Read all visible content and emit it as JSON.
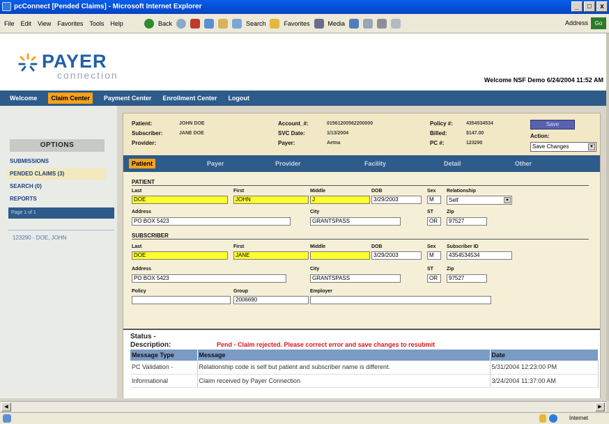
{
  "window": {
    "title": "pcConnect [Pended Claims] - Microsoft Internet Explorer",
    "buttons": [
      "_",
      "□",
      "x"
    ]
  },
  "toolbar": {
    "menus": [
      "File",
      "Edit",
      "View",
      "Favorites",
      "Tools",
      "Help"
    ],
    "back": "Back",
    "search": "Search",
    "favorites": "Favorites",
    "media": "Media",
    "address_label": "Address",
    "go": "Go"
  },
  "logo": {
    "word1": "PAYER",
    "word2": "connection"
  },
  "welcome_text": "Welcome NSF Demo 6/24/2004 11:52 AM",
  "topnav": [
    "Welcome",
    "Claim Center",
    "Payment Center",
    "Enrollment Center",
    "Logout"
  ],
  "left": {
    "options_header": "OPTIONS",
    "items": [
      "SUBMISSIONS",
      "PENDED CLAIMS (3)",
      "SEARCH (0)",
      "REPORTS"
    ],
    "page": "Page 1 of 1",
    "claim": "123290 - DOE, JOHN"
  },
  "header": {
    "patient_label": "Patient:",
    "patient": "JOHN DOE",
    "subscriber_label": "Subscriber:",
    "subscriber": "JANE DOE",
    "provider_label": "Provider:",
    "provider": "",
    "account_label": "Account_#:",
    "account": "01561200562200000",
    "svc_label": "SVC Date:",
    "svc": "1/13/2004",
    "payer_label": "Payer:",
    "payer": "Aetna",
    "policy_label": "Policy #:",
    "policy": "4354534534",
    "billed_label": "Billed:",
    "billed": "$147.00",
    "pc_label": "PC #:",
    "pc": "123290",
    "save": "Save",
    "action_label": "Action:",
    "action": "Save Changes"
  },
  "tabs": [
    "Patient",
    "Payer",
    "Provider",
    "Facility",
    "Detail",
    "Other"
  ],
  "patient": {
    "section": "PATIENT",
    "labels": {
      "last": "Last",
      "first": "First",
      "middle": "Middle",
      "dob": "DOB",
      "sex": "Sex",
      "relationship": "Relationship",
      "address": "Address",
      "city": "City",
      "st": "ST",
      "zip": "Zip"
    },
    "last": "DOE",
    "first": "JOHN",
    "middle": "J",
    "dob": "3/29/2003",
    "sex": "M",
    "relationship": "Self",
    "address": "PO BOX 5423",
    "city": "GRANTSPASS",
    "st": "OR",
    "zip": "97527"
  },
  "subscriber": {
    "section": "SUBSCRIBER",
    "labels": {
      "last": "Last",
      "first": "First",
      "middle": "Middle",
      "dob": "DOB",
      "sex": "Sex",
      "subscriber_id": "Subscriber ID",
      "address": "Address",
      "city": "City",
      "st": "ST",
      "zip": "Zip",
      "policy": "Policy",
      "group": "Group",
      "employer": "Employer"
    },
    "last": "DOE",
    "first": "JANE",
    "middle": "",
    "dob": "3/29/2003",
    "sex": "M",
    "subscriber_id": "4354534534",
    "address": "PO BOX 5423",
    "city": "GRANTSPASS",
    "st": "OR",
    "zip": "97527",
    "policy": "",
    "group": "2006690",
    "employer": ""
  },
  "status": {
    "label1": "Status -",
    "label2": "Description:",
    "message": "Pend - Claim rejected. Please correct error and save changes to resubmit",
    "columns": [
      "Message Type",
      "Message",
      "Date"
    ],
    "rows": [
      [
        "PC Validation -",
        "Relationship code is self but patient and subscriber name is different.",
        "5/31/2004 12:23:00 PM"
      ],
      [
        "Informational",
        "Claim received by Payer Connection",
        "3/24/2004 11:37:00 AM"
      ]
    ]
  },
  "statusbar": {
    "zone": "Internet"
  },
  "colors": {
    "nav": "#2d5b8a",
    "active_tab": "#f7a21b",
    "required_field": "#ffff2e",
    "error_text": "#e0141a"
  }
}
